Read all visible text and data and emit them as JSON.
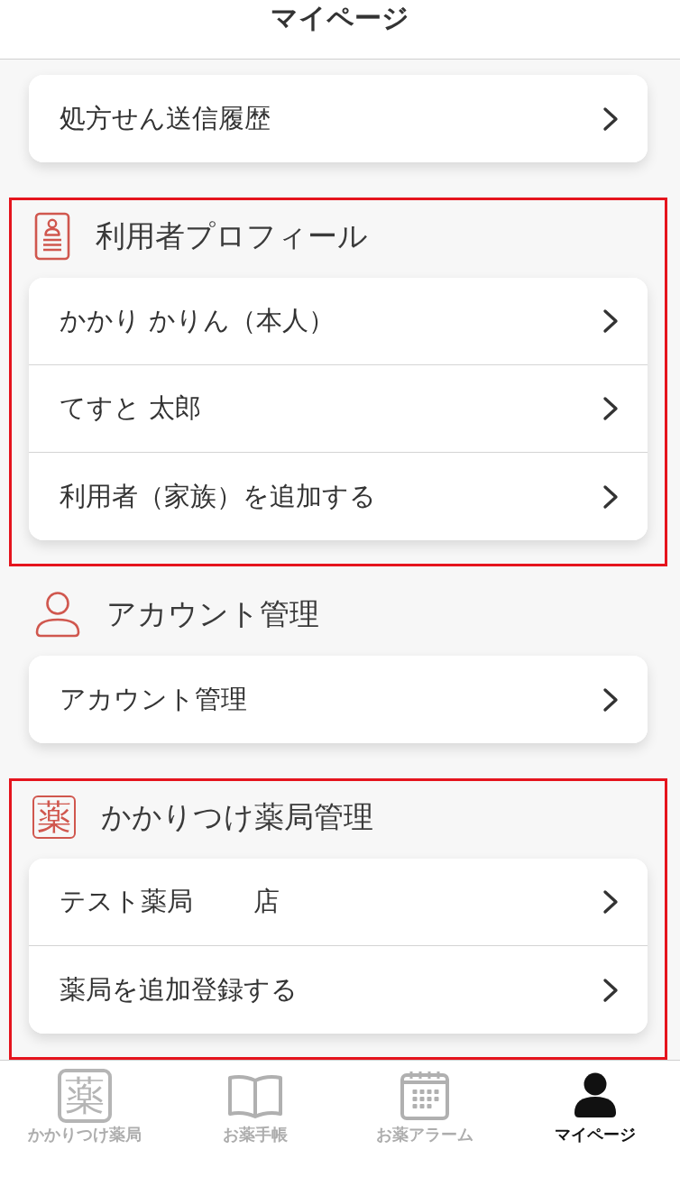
{
  "header": {
    "title": "マイページ"
  },
  "sections": [
    {
      "highlighted": false,
      "items": [
        {
          "label": "処方せん送信履歴"
        }
      ]
    },
    {
      "title": "利用者プロフィール",
      "highlighted": true,
      "items": [
        {
          "label": "かかり かりん（本人）"
        },
        {
          "label": "てすと 太郎"
        },
        {
          "label": "利用者（家族）を追加する"
        }
      ]
    },
    {
      "title": "アカウント管理",
      "highlighted": false,
      "items": [
        {
          "label": "アカウント管理"
        }
      ]
    },
    {
      "title": "かかりつけ薬局管理",
      "glyph": "薬",
      "highlighted": true,
      "items": [
        {
          "label": "テスト薬局　　 店"
        },
        {
          "label": "薬局を追加登録する"
        }
      ]
    }
  ],
  "tab_bar": {
    "tabs": [
      {
        "label": "かかりつけ薬局",
        "glyph": "薬",
        "selected": false
      },
      {
        "label": "お薬手帳",
        "selected": false
      },
      {
        "label": "お薬アラーム",
        "selected": false
      },
      {
        "label": "マイページ",
        "selected": true
      }
    ]
  }
}
